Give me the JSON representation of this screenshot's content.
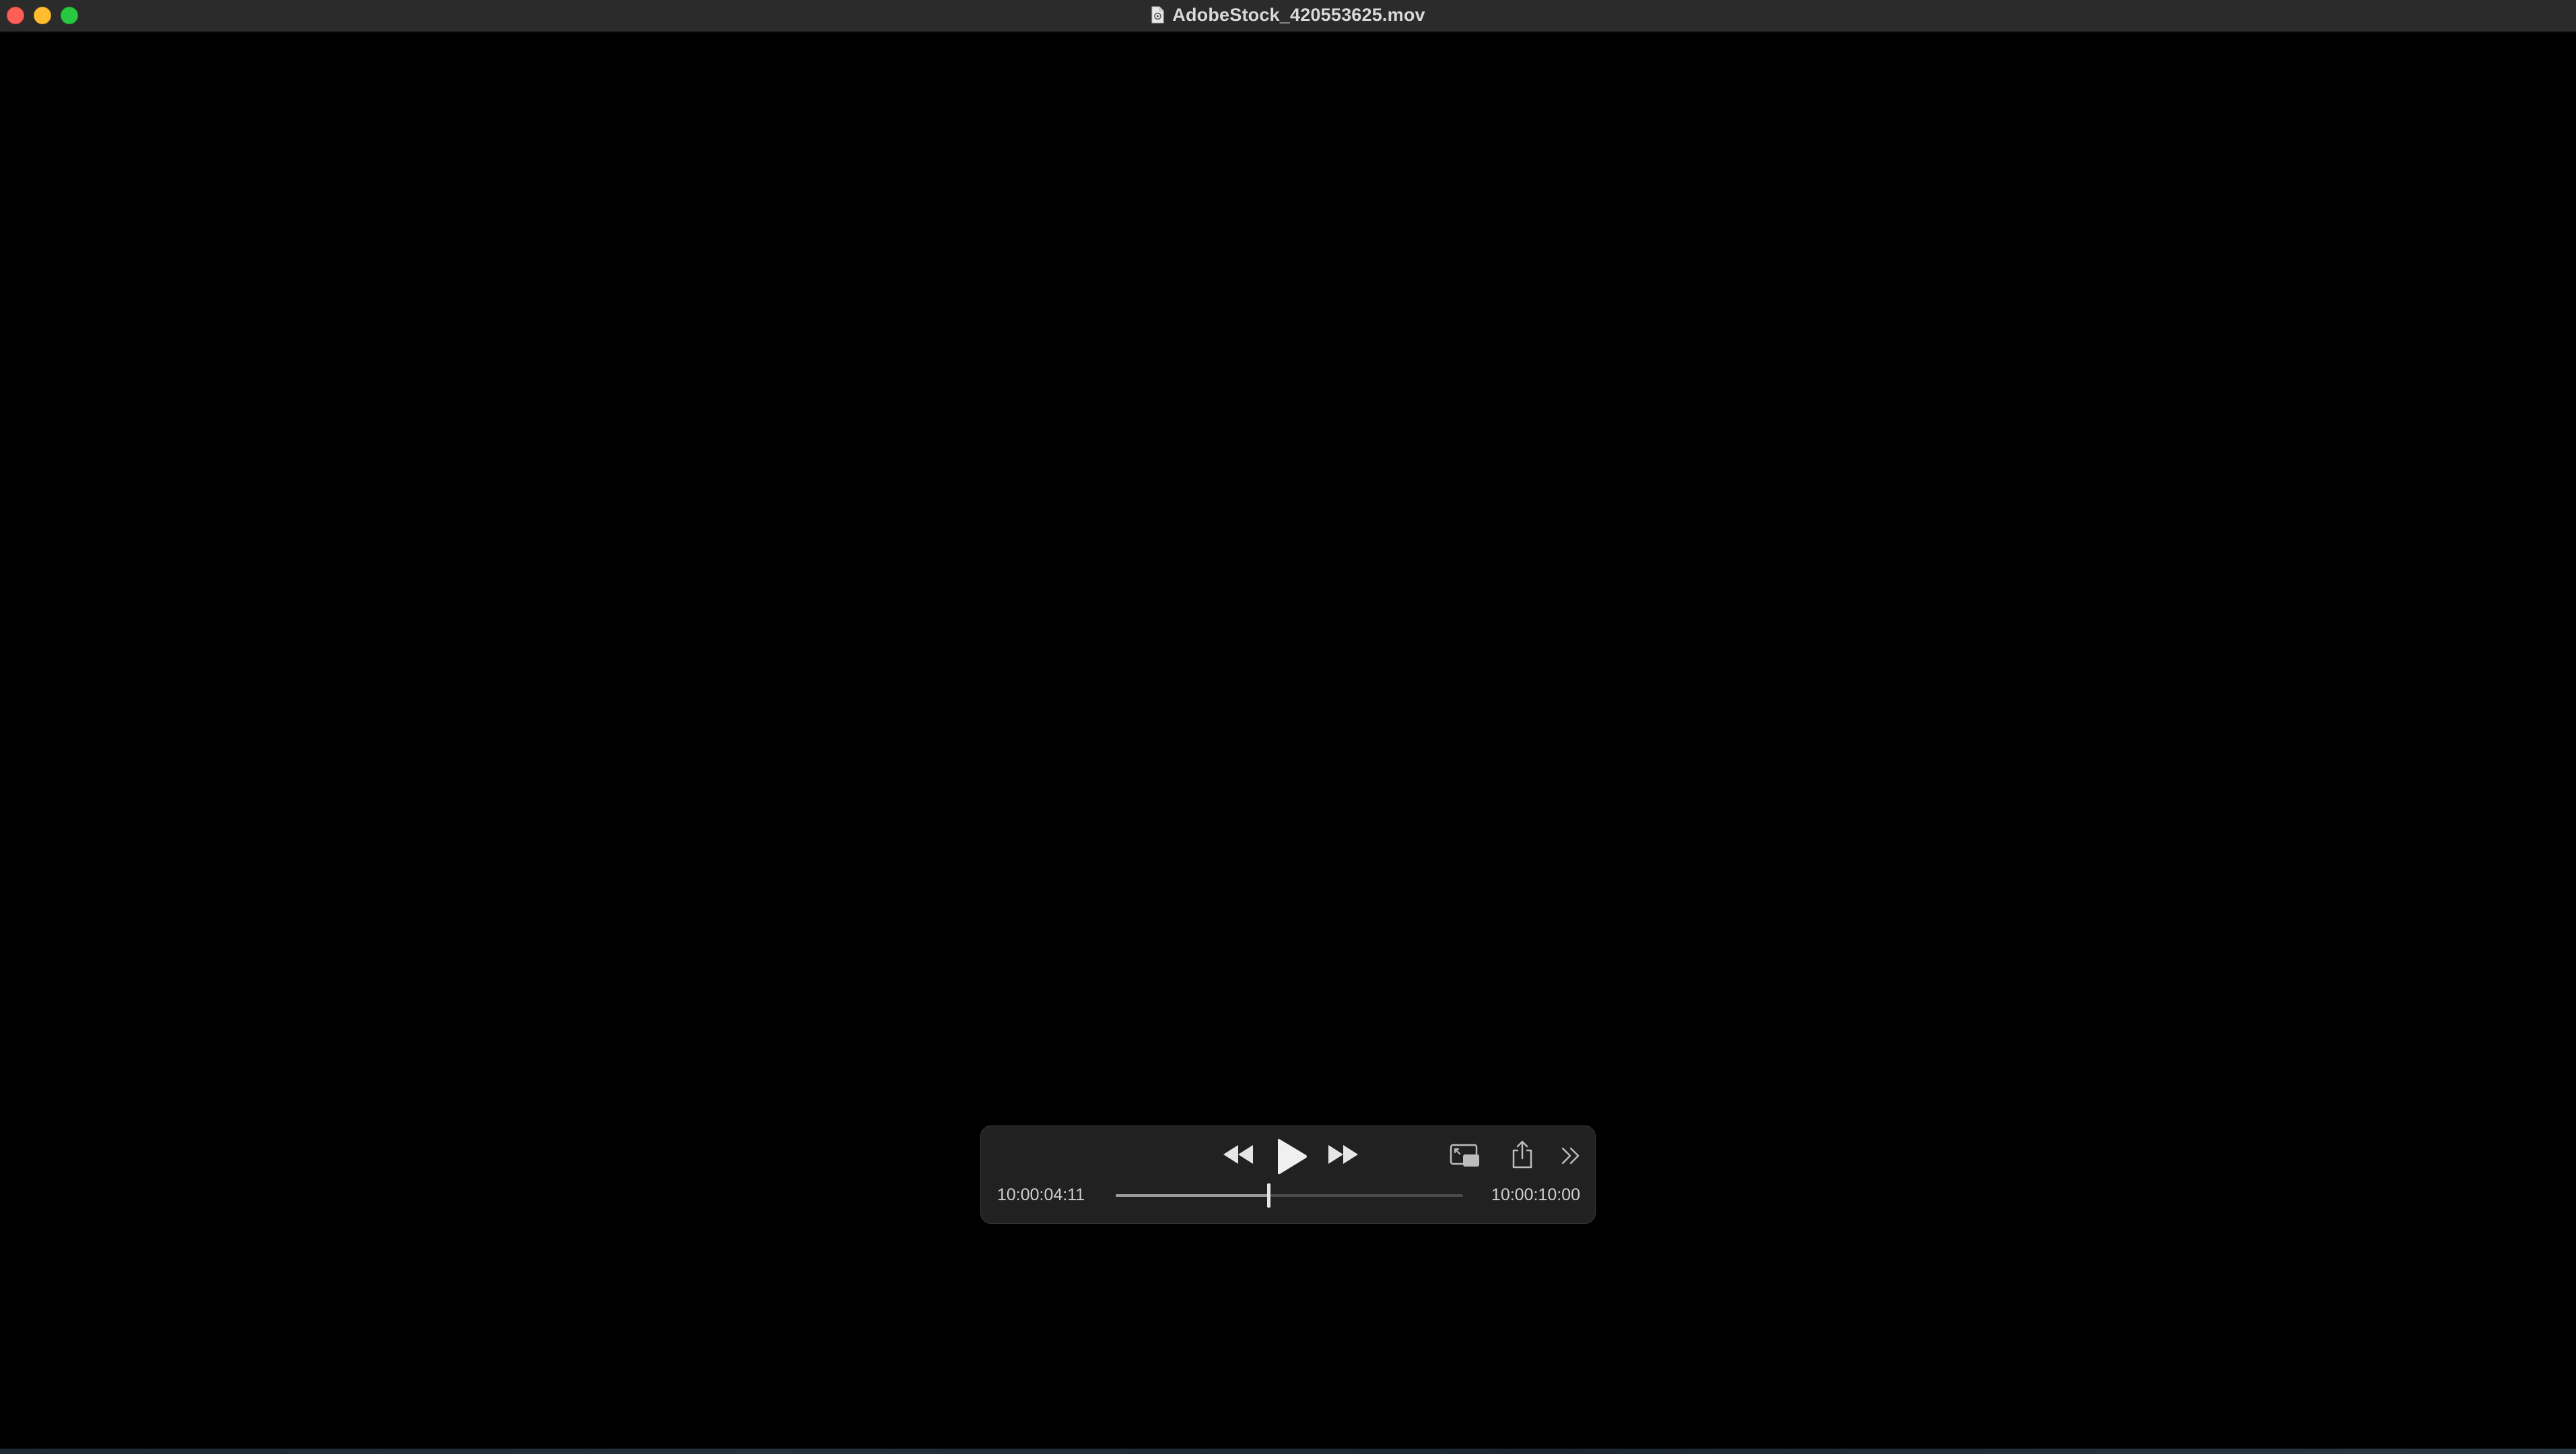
{
  "window": {
    "title": "AdobeStock_420553625.mov"
  },
  "icons": {
    "close": "close-window-icon",
    "minimize": "minimize-window-icon",
    "zoom": "zoom-window-icon",
    "document": "document-icon",
    "rewind": "rewind-icon",
    "play": "play-icon",
    "fast_forward": "fast-forward-icon",
    "pip": "picture-in-picture-icon",
    "share": "share-icon",
    "more": "double-chevron-right-icon"
  },
  "player": {
    "current_time": "10:00:04:11",
    "total_time": "10:00:10:00",
    "progress": 0.44
  },
  "colors": {
    "close": "#ff5f57",
    "minimize": "#febc2e",
    "zoom": "#28c840",
    "hud_background": "#222222",
    "track": "#4b4b4b",
    "track_fill": "#9a9a9a"
  }
}
